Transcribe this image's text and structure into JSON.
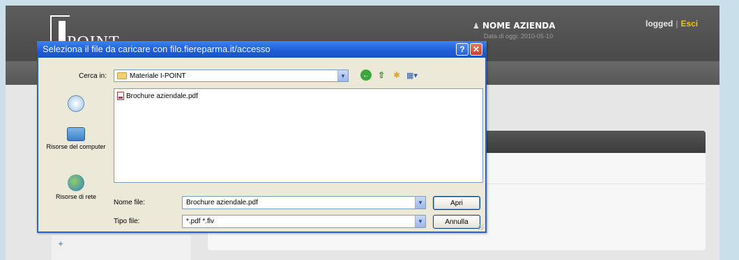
{
  "site": {
    "logo_text": "POINT",
    "company_name": "NOME AZIENDA",
    "date_line": "Data di oggi: 2010-05-10",
    "logged_label": "logged",
    "separator": "|",
    "logout_label": "Esci"
  },
  "dialog": {
    "title": "Seleziona il file da caricare con filo.fiereparma.it/accesso",
    "help_glyph": "?",
    "close_glyph": "✕",
    "look_in_label": "Cerca in:",
    "look_in_value": "Materiale I-POINT",
    "places": [
      {
        "label": ""
      },
      {
        "label": "Risorse del computer"
      },
      {
        "label": "Risorse di rete"
      }
    ],
    "files": [
      {
        "name": "Brochure aziendale.pdf"
      }
    ],
    "file_name_label": "Nome file:",
    "file_name_value": "Brochure aziendale.pdf",
    "file_type_label": "Tipo file:",
    "file_type_value": "*.pdf  *.flv",
    "open_button": "Apri",
    "cancel_button": "Annulla"
  },
  "icons": {
    "back": "back-icon",
    "up": "up-folder-icon",
    "new_folder": "new-folder-icon",
    "views": "views-menu-icon"
  },
  "colors": {
    "titlebar": "#1e5ed8",
    "dialog_bg": "#ece9d8",
    "site_header": "#4a4a4a",
    "logout_link": "#f0c419"
  }
}
